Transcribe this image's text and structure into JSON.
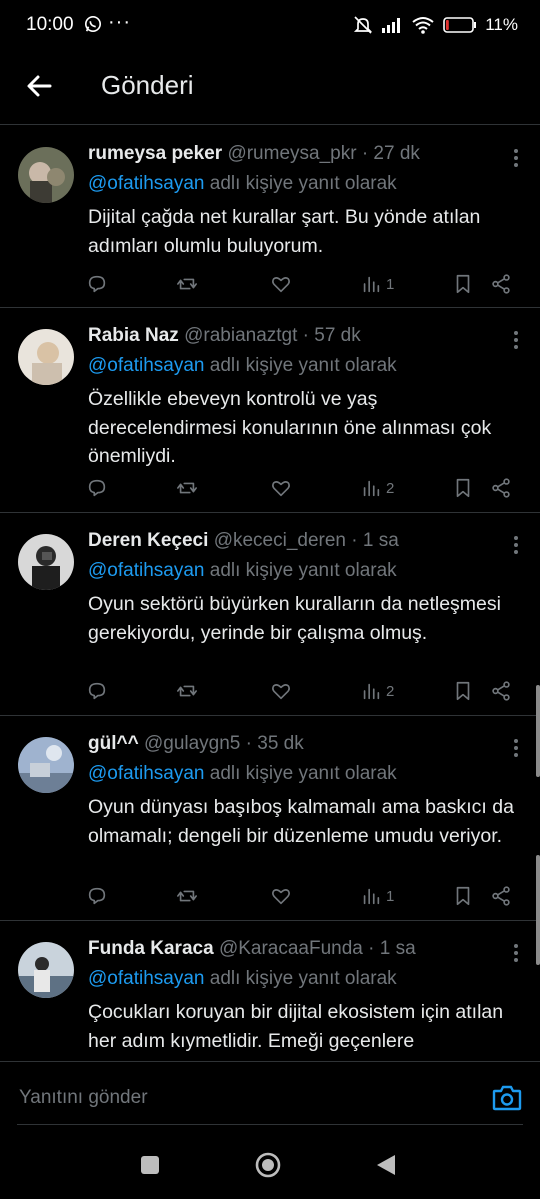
{
  "status_bar": {
    "time": "10:00",
    "battery_percent": "11%",
    "battery_level": 0.11,
    "battery_color": "#e0322f"
  },
  "header": {
    "title": "Gönderi",
    "back_icon": "arrow-left-icon"
  },
  "colors": {
    "accent": "#1d9bf0",
    "text": "#e7e9ea",
    "muted": "#71767b",
    "divider": "#2f3336"
  },
  "reply_suffix": " adlı kişiye yanıt olarak",
  "posts": [
    {
      "name": "rumeysa peker",
      "meta": "@rumeysa_pkr · 27 dk",
      "reply_to": "@ofatihsayan",
      "text": "Dijital çağda net kurallar şart. Bu yönde atılan adımları olumlu buluyorum.",
      "views": "1"
    },
    {
      "name": "Rabia Naz",
      "meta": "@rabianaztgt · 57 dk",
      "reply_to": "@ofatihsayan",
      "text": "Özellikle ebeveyn kontrolü ve yaş derecelendirmesi konularının öne alınması çok önemliydi.",
      "views": "2"
    },
    {
      "name": "Deren Keçeci",
      "meta": "@kececi_deren · 1 sa",
      "reply_to": "@ofatihsayan",
      "text": "Oyun sektörü büyürken kuralların da netleşmesi gerekiyordu, yerinde bir çalışma olmuş.",
      "views": "2"
    },
    {
      "name": "gül^^",
      "meta": "@gulaygn5 · 35 dk",
      "reply_to": "@ofatihsayan",
      "text": "Oyun dünyası başıboş kalmamalı ama baskıcı da olmamalı; dengeli bir düzenleme umudu veriyor.",
      "views": "1"
    },
    {
      "name": "Funda Karaca",
      "meta": "@KaracaaFunda · 1 sa",
      "reply_to": "@ofatihsayan",
      "text": "Çocukları koruyan bir dijital ekosistem için atılan her adım kıymetlidir. Emeği geçenlere teşekkürler.",
      "views": ""
    }
  ],
  "composer": {
    "placeholder": "Yanıtını gönder",
    "camera_icon": "camera-icon"
  }
}
